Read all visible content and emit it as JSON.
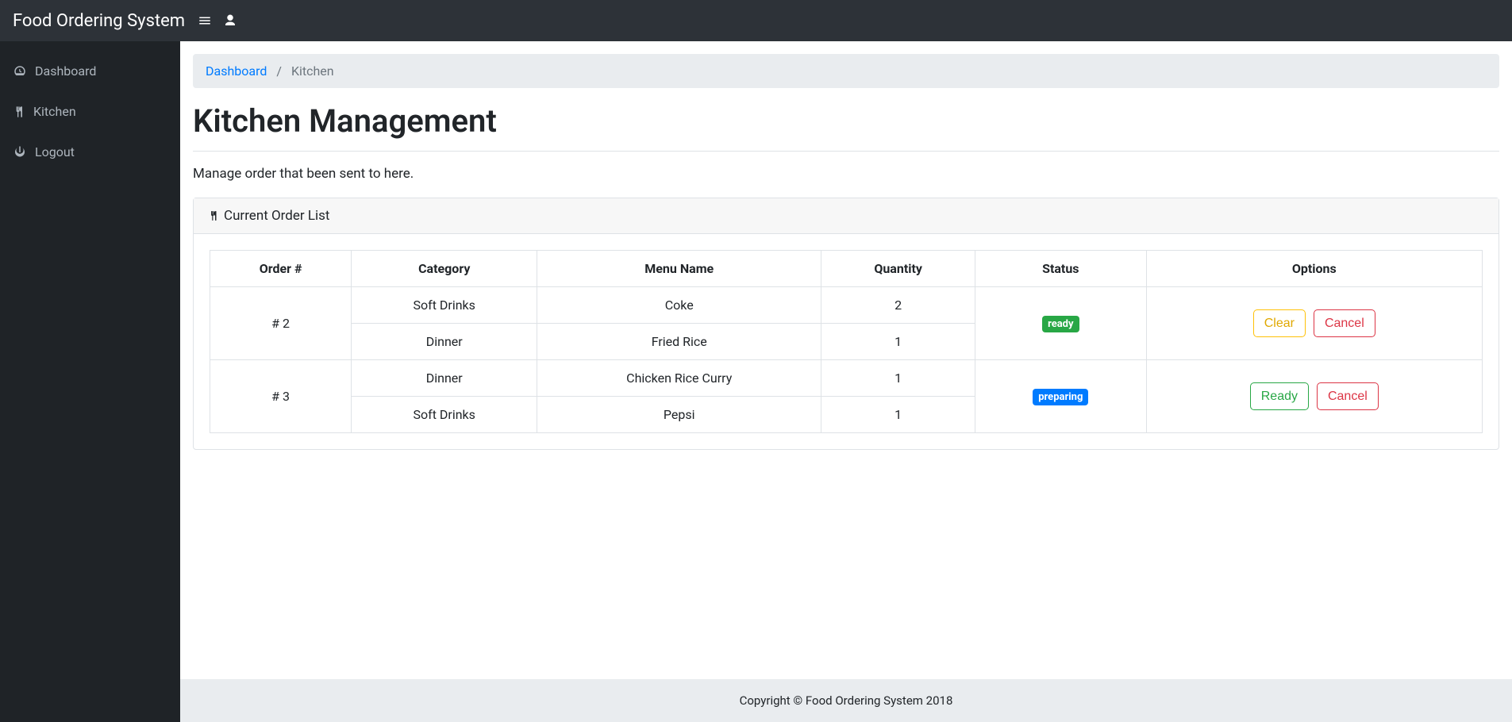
{
  "header": {
    "brand": "Food Ordering System"
  },
  "sidebar": {
    "items": [
      {
        "label": "Dashboard"
      },
      {
        "label": "Kitchen"
      },
      {
        "label": "Logout"
      }
    ]
  },
  "breadcrumb": {
    "root": "Dashboard",
    "current": "Kitchen",
    "sep": "/"
  },
  "page": {
    "title": "Kitchen Management",
    "lead": "Manage order that been sent to here."
  },
  "card": {
    "title": "Current Order List"
  },
  "table": {
    "headers": {
      "order": "Order #",
      "category": "Category",
      "menu": "Menu Name",
      "qty": "Quantity",
      "status": "Status",
      "options": "Options"
    },
    "orders": {
      "o2": {
        "order_label": "# 2",
        "status_label": "ready",
        "status_color": "badge-success",
        "action_primary": "Clear",
        "action_secondary": "Cancel",
        "items": [
          {
            "category": "Soft Drinks",
            "menu": "Coke",
            "qty": "2"
          },
          {
            "category": "Dinner",
            "menu": "Fried Rice",
            "qty": "1"
          }
        ]
      },
      "o3": {
        "order_label": "# 3",
        "status_label": "preparing",
        "status_color": "badge-primary",
        "action_primary": "Ready",
        "action_secondary": "Cancel",
        "items": [
          {
            "category": "Dinner",
            "menu": "Chicken Rice Curry",
            "qty": "1"
          },
          {
            "category": "Soft Drinks",
            "menu": "Pepsi",
            "qty": "1"
          }
        ]
      }
    }
  },
  "footer": {
    "text": "Copyright © Food Ordering System 2018"
  }
}
